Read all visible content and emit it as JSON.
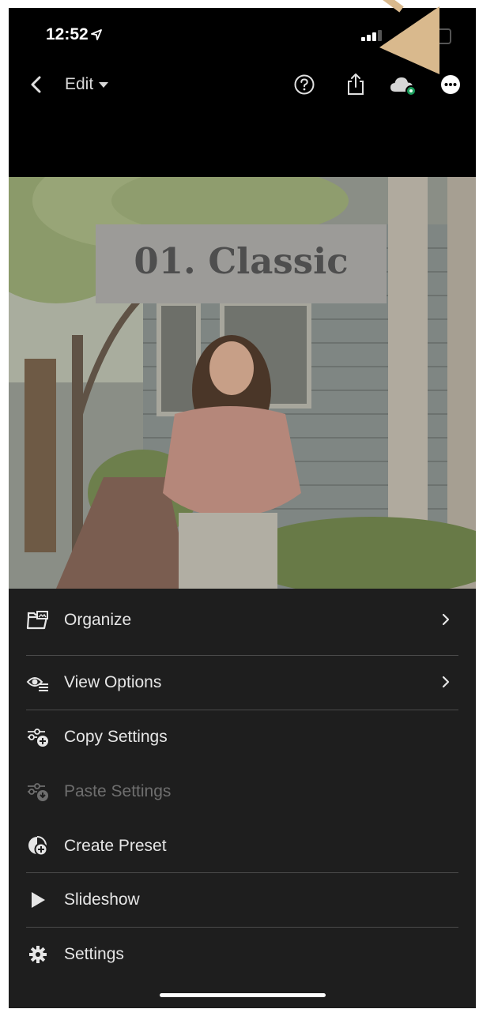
{
  "status": {
    "time": "12:52"
  },
  "nav": {
    "edit_label": "Edit"
  },
  "photo": {
    "sign_text": "01. Classic"
  },
  "menu": {
    "items": [
      {
        "label": "Organize",
        "icon": "folder-image-icon",
        "has_chevron": true,
        "disabled": false
      },
      {
        "label": "View Options",
        "icon": "view-options-icon",
        "has_chevron": true,
        "disabled": false
      },
      {
        "label": "Copy Settings",
        "icon": "copy-settings-icon",
        "has_chevron": false,
        "disabled": false
      },
      {
        "label": "Paste Settings",
        "icon": "paste-settings-icon",
        "has_chevron": false,
        "disabled": true
      },
      {
        "label": "Create Preset",
        "icon": "create-preset-icon",
        "has_chevron": false,
        "disabled": false
      },
      {
        "label": "Slideshow",
        "icon": "play-icon",
        "has_chevron": false,
        "disabled": false
      },
      {
        "label": "Settings",
        "icon": "gear-icon",
        "has_chevron": false,
        "disabled": false
      }
    ]
  },
  "colors": {
    "menu_bg": "#1e1e1e",
    "annotation_arrow": "#d9b98d",
    "cloud_status_dot": "#1a9c5b"
  }
}
